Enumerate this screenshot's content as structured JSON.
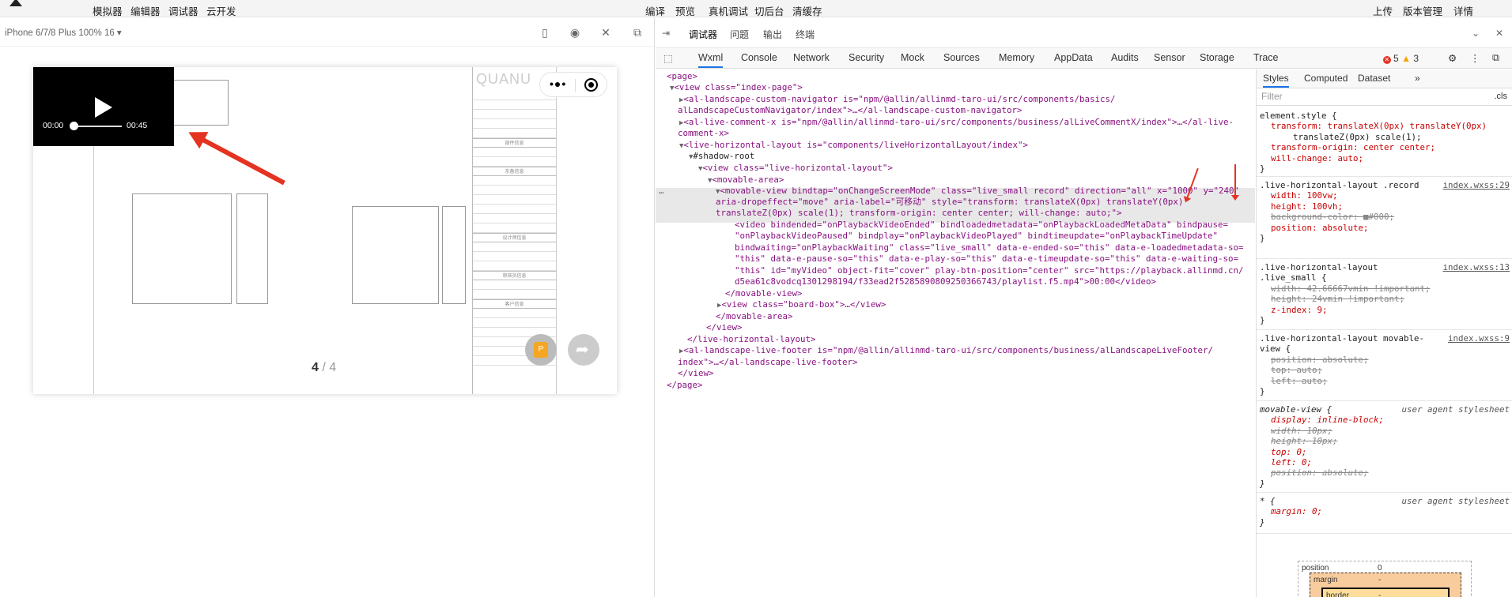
{
  "menubar": {
    "left": [
      "模拟器",
      "编辑器",
      "调试器",
      "云开发"
    ],
    "center": [
      "编译",
      "预览",
      "真机调试",
      "切后台",
      "清缓存"
    ],
    "right": [
      "上传",
      "版本管理",
      "详情"
    ]
  },
  "simulator": {
    "device": "iPhone 6/7/8 Plus 100% 16 ▾",
    "video": {
      "current": "00:00",
      "duration": "00:45",
      "progress": 0
    },
    "brand": "QUANU",
    "pager": {
      "current": "4",
      "sep": " / ",
      "total": "4"
    },
    "drawing_labels": [
      "部件信息",
      "东备信息",
      "设计师信息",
      "审核员信息",
      "客户信息"
    ],
    "fab_badge": "P"
  },
  "devtools": {
    "top_tabs": [
      "调试器",
      "问题",
      "输出",
      "终端"
    ],
    "panel_tabs": [
      "Wxml",
      "Console",
      "Network",
      "Security",
      "Mock",
      "Sources",
      "Memory",
      "AppData",
      "Audits",
      "Sensor",
      "Storage",
      "Trace"
    ],
    "errors": "5",
    "warnings": "3",
    "style_tabs": [
      "Styles",
      "Computed",
      "Dataset"
    ],
    "filter_placeholder": "Filter",
    "cls_label": ".cls",
    "dom": {
      "l1": "<page>",
      "l2": "<view class=\"index-page\">",
      "l3a": "<al-landscape-custom-navigator is=\"npm/@allin/allinmd-taro-ui/src/components/basics/",
      "l3b": "alLandscapeCustomNavigator/index\">…</al-landscape-custom-navigator>",
      "l4a": "<al-live-comment-x is=\"npm/@allin/allinmd-taro-ui/src/components/business/alLiveCommentX/index\">…</al-live-",
      "l4b": "comment-x>",
      "l5": "<live-horizontal-layout is=\"components/liveHorizontalLayout/index\">",
      "l6": "#shadow-root",
      "l7": "<view class=\"live-horizontal-layout\">",
      "l8": "<movable-area>",
      "l9a": "<movable-view bindtap=\"onChangeScreenMode\" class=\"live_small record\" direction=\"all\" x=\"1000\" y=\"240\"",
      "l9b": "aria-dropeffect=\"move\" aria-label=\"可移动\" style=\"transform: translateX(0px) translateY(0px)",
      "l9c": "translateZ(0px) scale(1); transform-origin: center center; will-change: auto;\">",
      "l10a": "<video bindended=\"onPlaybackVideoEnded\" bindloadedmetadata=\"onPlaybackLoadedMetaData\" bindpause=",
      "l10b": "\"onPlaybackVideoPaused\" bindplay=\"onPlaybackVideoPlayed\" bindtimeupdate=\"onPlaybackTimeUpdate\"",
      "l10c": "bindwaiting=\"onPlaybackWaiting\" class=\"live_small\" data-e-ended-so=\"this\" data-e-loadedmetadata-so=",
      "l10d": "\"this\" data-e-pause-so=\"this\" data-e-play-so=\"this\" data-e-timeupdate-so=\"this\" data-e-waiting-so=",
      "l10e": "\"this\" id=\"myVideo\" object-fit=\"cover\" play-btn-position=\"center\" src=\"https://playback.allinmd.cn/",
      "l10f": "d5ea61c8vodcq1301298194/f33ead2f5285890809250366743/playlist.f5.mp4\">00:00</video>",
      "l11": "</movable-view>",
      "l12": "<view class=\"board-box\">…</view>",
      "l13": "</movable-area>",
      "l14": "</view>",
      "l15": "</live-horizontal-layout>",
      "l16a": "<al-landscape-live-footer is=\"npm/@allin/allinmd-taro-ui/src/components/business/alLandscapeLiveFooter/",
      "l16b": "index\">…</al-landscape-live-footer>",
      "l17": "</view>",
      "l18": "</page>"
    },
    "styles": {
      "element_style": "element.style {",
      "es_p1": "transform: translateX(0px) translateY(0px)",
      "es_p1b": "translateZ(0px) scale(1);",
      "es_p2": "transform-origin: center center;",
      "es_p3": "will-change: auto;",
      "r1_sel": ".live-horizontal-layout .record",
      "r1_src": "index.wxss:29",
      "r1_p1": "width: 100vw;",
      "r1_p2": "height: 100vh;",
      "r1_p3": "background-color: ■#000;",
      "r1_p4": "position: absolute;",
      "r2_sel": ".live-horizontal-layout",
      "r2_sel2": ".live_small {",
      "r2_src": "index.wxss:13",
      "r2_p1": "width: 42.66667vmin !important;",
      "r2_p2": "height: 24vmin !important;",
      "r2_p3": "z-index: 9;",
      "r3_sel": ".live-horizontal-layout movable-",
      "r3_sel2": "view {",
      "r3_src": "index.wxss:9",
      "r3_p1": "position: absolute;",
      "r3_p2": "top: auto;",
      "r3_p3": "left: auto;",
      "r4_sel": "movable-view {",
      "r4_src": "user agent stylesheet",
      "r4_p1": "display: inline-block;",
      "r4_p2": "width: 10px;",
      "r4_p3": "height: 10px;",
      "r4_p4": "top: 0;",
      "r4_p5": "left: 0;",
      "r4_p6": "position: absolute;",
      "r5_sel": "* {",
      "r5_src": "user agent stylesheet",
      "r5_p1": "margin: 0;",
      "close": "}",
      "box_position": "position",
      "box_position_val": "0",
      "box_margin": "margin",
      "box_margin_val": "-",
      "box_border": "border",
      "box_border_val": "-"
    }
  },
  "colors": {
    "accent": "#1a73e8",
    "annotation": "#e53322"
  }
}
